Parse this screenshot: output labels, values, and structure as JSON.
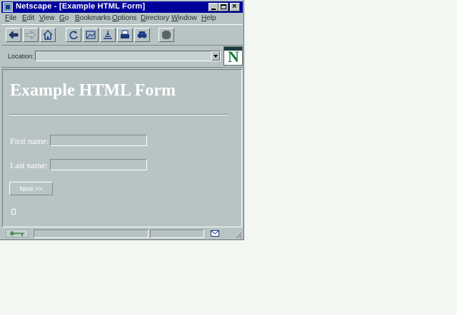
{
  "window": {
    "title": "Netscape - [Example HTML Form]",
    "controls": [
      "minimize",
      "maximize",
      "close"
    ]
  },
  "menu": {
    "items": [
      "File",
      "Edit",
      "View",
      "Go",
      "Bookmarks",
      "Options",
      "Directory",
      "Window",
      "Help"
    ]
  },
  "toolbar": {
    "buttons": [
      "back-icon",
      "forward-icon",
      "home-icon",
      "reload-icon",
      "images-icon",
      "open-icon",
      "print-icon",
      "find-icon",
      "stop-icon"
    ]
  },
  "location": {
    "label": "Location:",
    "value": ""
  },
  "page": {
    "heading": "Example HTML Form",
    "first_name_label": "First name:",
    "first_name_value": "",
    "last_name_label": "Last name:",
    "last_name_value": "",
    "next_button": "Next >>"
  },
  "colors": {
    "titlebar": "#00009c",
    "chrome": "#b8c4c4",
    "desktop": "#f2f7f2",
    "page_text": "#ffffff"
  }
}
